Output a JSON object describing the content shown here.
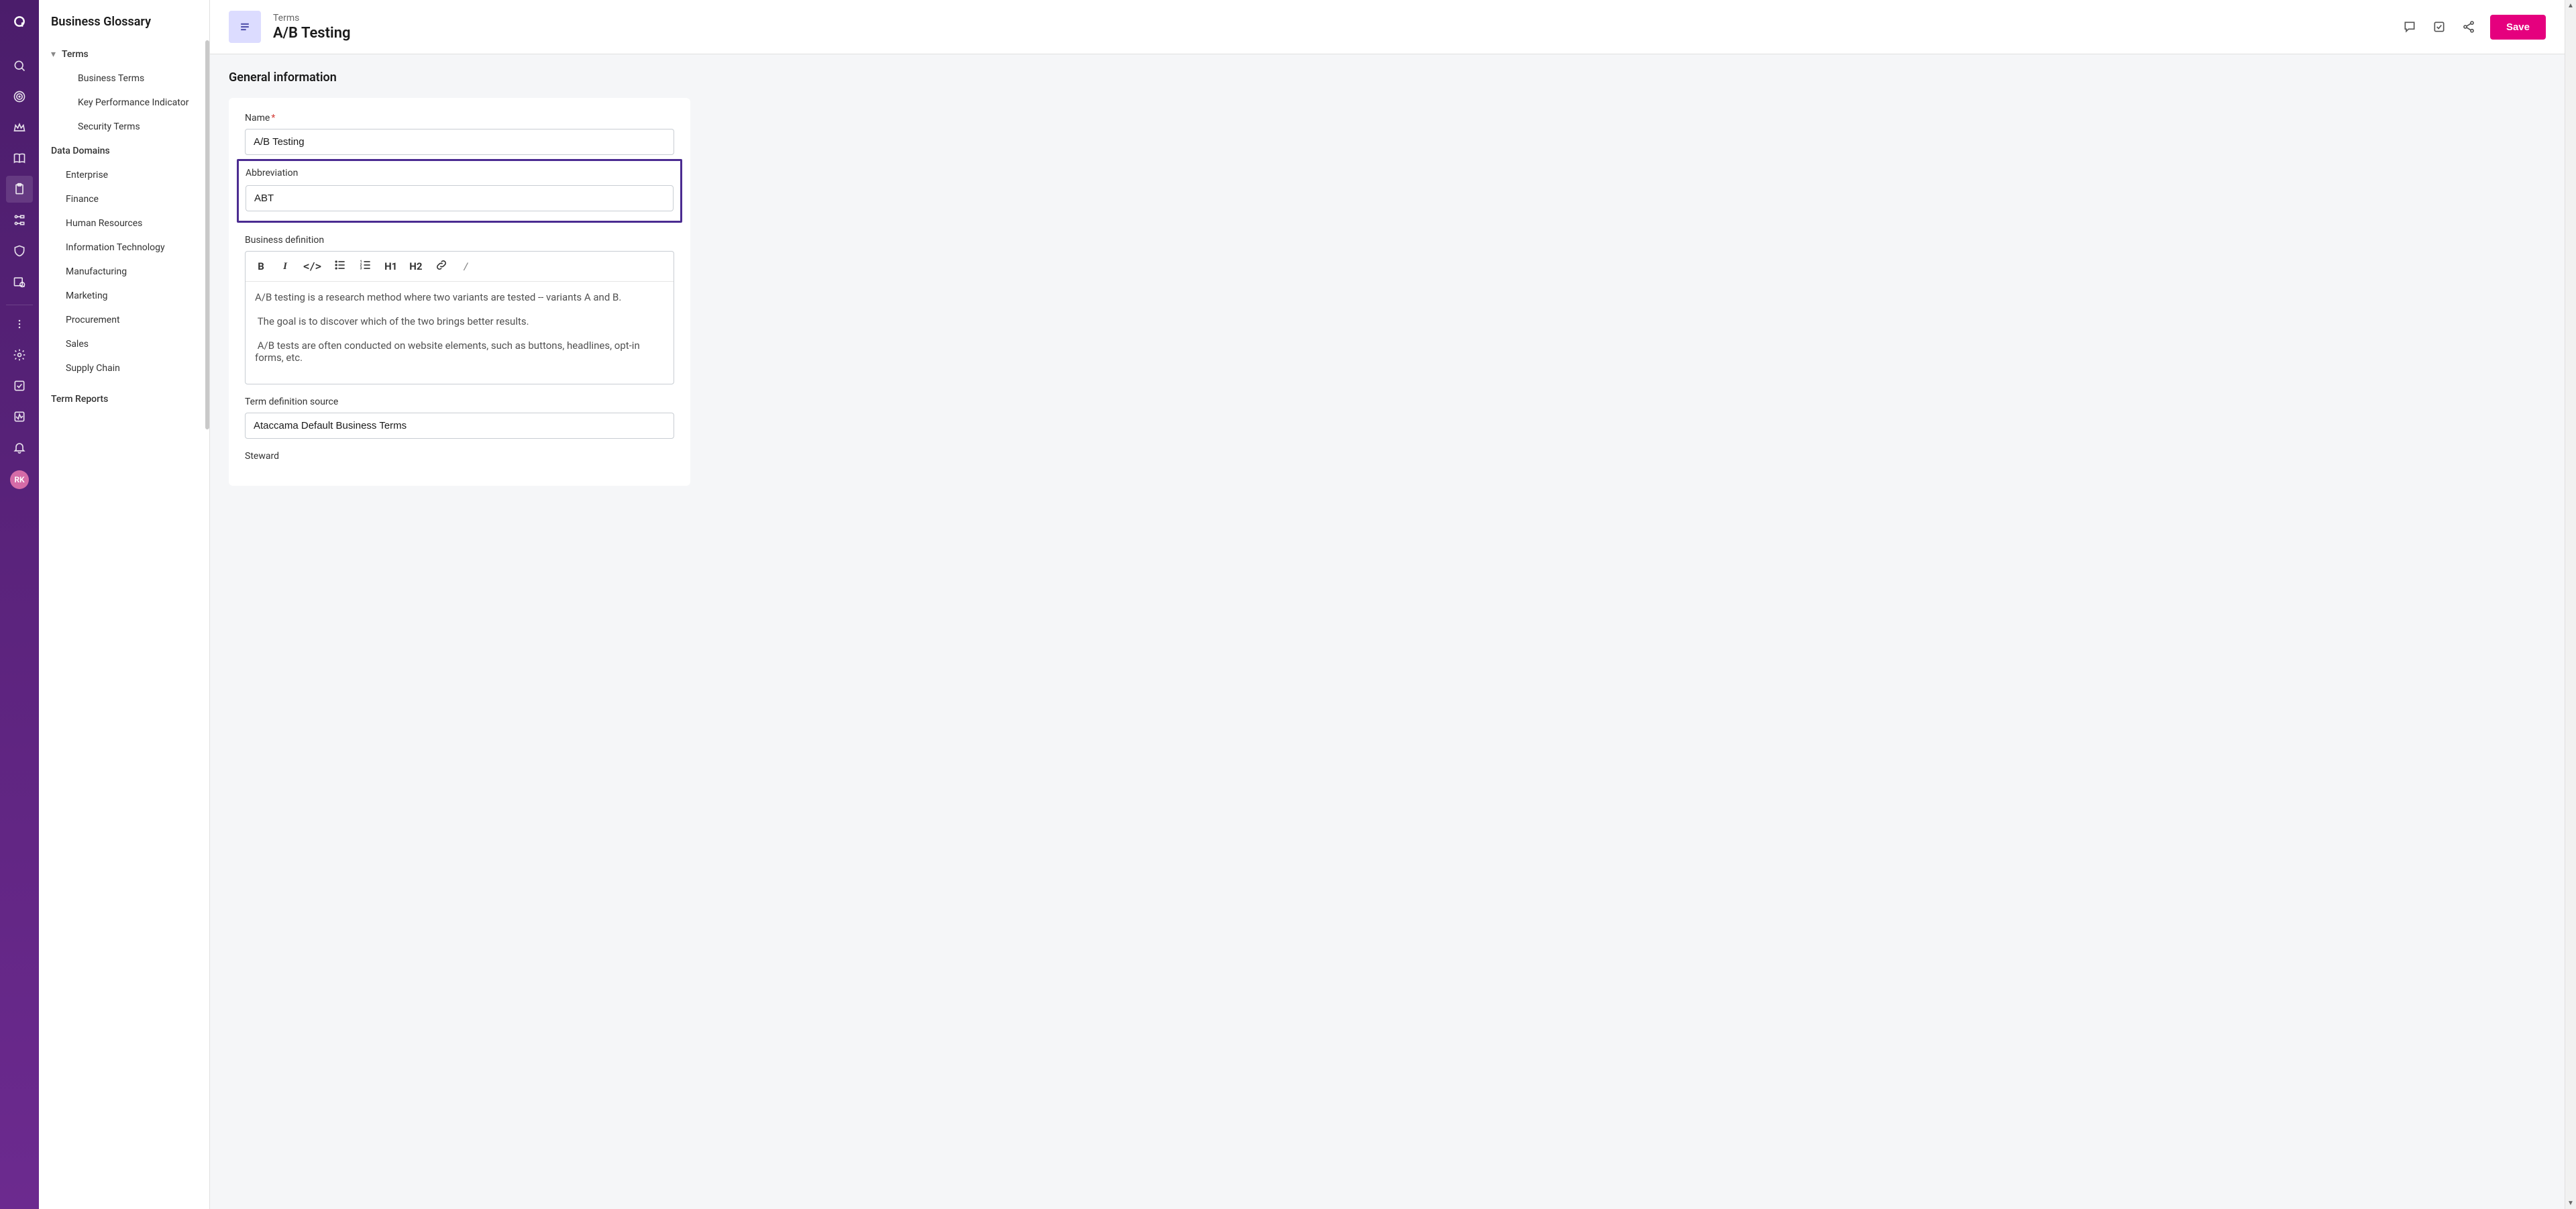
{
  "rail": {
    "avatar_initials": "RK"
  },
  "left_panel": {
    "title": "Business Glossary",
    "tree": {
      "terms_label": "Terms",
      "terms_children": {
        "business_terms": "Business Terms",
        "kpi": "Key Performance Indicator",
        "security_terms": "Security Terms"
      },
      "data_domains_label": "Data Domains",
      "domains": {
        "enterprise": "Enterprise",
        "finance": "Finance",
        "hr": "Human Resources",
        "it": "Information Technology",
        "manufacturing": "Manufacturing",
        "marketing": "Marketing",
        "procurement": "Procurement",
        "sales": "Sales",
        "supply_chain": "Supply Chain"
      },
      "term_reports_label": "Term Reports"
    }
  },
  "header": {
    "breadcrumb": "Terms",
    "title": "A/B Testing",
    "save_label": "Save"
  },
  "form": {
    "section_heading": "General information",
    "name_label": "Name",
    "name_value": "A/B Testing",
    "abbr_label": "Abbreviation",
    "abbr_value": "ABT",
    "definition_label": "Business definition",
    "definition_value": "A/B testing is a research method where two variants are tested -- variants A and B.\n\n The goal is to discover which of the two brings better results.\n\n A/B tests are often conducted on website elements, such as buttons, headlines, opt-in forms, etc.",
    "source_label": "Term definition source",
    "source_value": "Ataccama Default Business Terms",
    "steward_label": "Steward",
    "rte_toolbar": {
      "bold": "B",
      "italic": "I",
      "code": "</>",
      "h1": "H1",
      "h2": "H2",
      "slash": "/"
    }
  }
}
